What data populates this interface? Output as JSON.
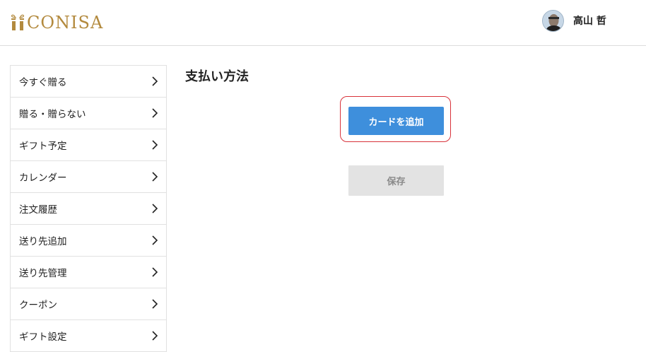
{
  "header": {
    "logo_text": "CONISA",
    "user_name": "高山 哲"
  },
  "sidebar": {
    "items": [
      {
        "label": "今すぐ贈る",
        "icon": "chevron-right-icon"
      },
      {
        "label": "贈る・贈らない",
        "icon": "chevron-right-icon"
      },
      {
        "label": "ギフト予定",
        "icon": "chevron-right-icon"
      },
      {
        "label": "カレンダー",
        "icon": "chevron-right-icon"
      },
      {
        "label": "注文履歴",
        "icon": "chevron-right-icon"
      },
      {
        "label": "送り先追加",
        "icon": "chevron-right-icon"
      },
      {
        "label": "送り先管理",
        "icon": "chevron-right-icon"
      },
      {
        "label": "クーポン",
        "icon": "chevron-right-icon"
      },
      {
        "label": "ギフト設定",
        "icon": "chevron-right-icon"
      }
    ]
  },
  "main": {
    "title": "支払い方法",
    "add_card_label": "カードを追加",
    "save_label": "保存"
  },
  "colors": {
    "brand_gold": "#b38a3e",
    "primary_blue": "#3e8fdc",
    "highlight_red": "#d8323a",
    "disabled_gray": "#e3e3e3"
  }
}
